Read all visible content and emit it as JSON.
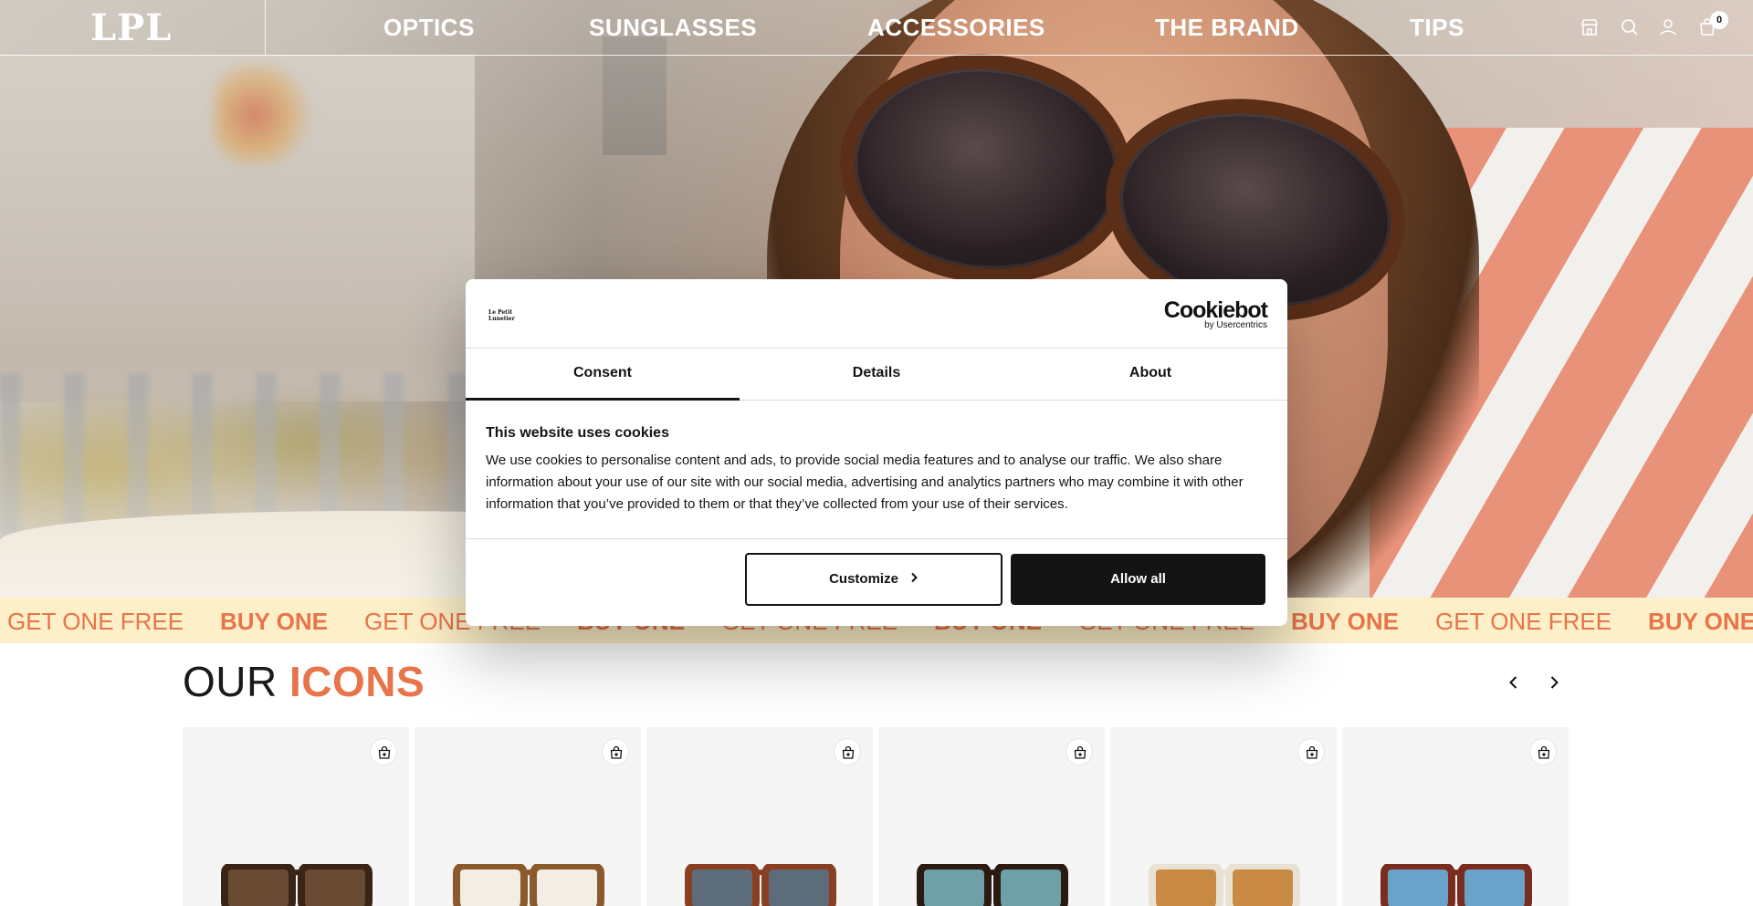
{
  "header": {
    "logo": "LPL",
    "nav": [
      {
        "label": "OPTICS"
      },
      {
        "label": "SUNGLASSES"
      },
      {
        "label": "ACCESSORIES"
      },
      {
        "label": "THE BRAND"
      },
      {
        "label": "TIPS"
      }
    ],
    "icons": [
      "store-icon",
      "search-icon",
      "account-icon",
      "cart-icon"
    ],
    "cart_count": "0"
  },
  "marquee": {
    "items": [
      "GET ONE FREE",
      "BUY ONE",
      "GET ONE FREE",
      "BUY ONE",
      "GET ONE FREE",
      "BUY ONE",
      "GET ONE FREE",
      "BUY ONE",
      "GET ONE FREE",
      "BUY ONE"
    ]
  },
  "icons_section": {
    "title_plain": "OUR",
    "title_accent": "ICONS",
    "accent_color": "#e8744a"
  },
  "products": [
    {
      "frame_color": "#3a2417",
      "lens_color": "#6b4a33"
    },
    {
      "frame_color": "#8a5a2b",
      "lens_color": "#f2eee6"
    },
    {
      "frame_color": "#8a3f22",
      "lens_color": "#5d6c7a"
    },
    {
      "frame_color": "#2a1a12",
      "lens_color": "#6fa0a8"
    },
    {
      "frame_color": "#e9e2d4",
      "lens_color": "#c98b44"
    },
    {
      "frame_color": "#7a2d1e",
      "lens_color": "#6aa3c9"
    }
  ],
  "cookie_dialog": {
    "brand_logo": "Le Petit Lunetier",
    "provider_name": "Cookiebot",
    "provider_sub": "by Usercentrics",
    "tabs": [
      {
        "label": "Consent",
        "active": true
      },
      {
        "label": "Details",
        "active": false
      },
      {
        "label": "About",
        "active": false
      }
    ],
    "heading": "This website uses cookies",
    "body": "We use cookies to personalise content and ads, to provide social media features and to analyse our traffic. We also share information about your use of our site with our social media, advertising and analytics partners who may combine it with other information that you’ve provided to them or that they’ve collected from your use of their services.",
    "customize_label": "Customize",
    "allow_label": "Allow all"
  }
}
